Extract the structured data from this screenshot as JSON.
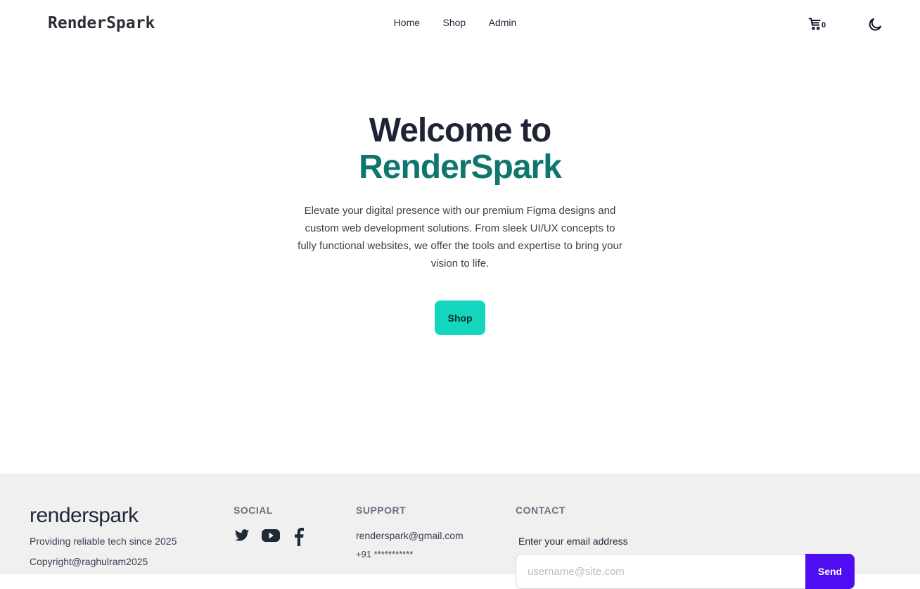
{
  "navbar": {
    "brand": "RenderSpark",
    "links": [
      "Home",
      "Shop",
      "Admin"
    ],
    "cart_count": "0",
    "cart_icon": "shopping-cart-icon",
    "theme_icon": "moon-icon"
  },
  "hero": {
    "title_line1": "Welcome to",
    "title_line2": "RenderSpark",
    "description": "Elevate your digital presence with our premium Figma designs and custom web development solutions. From sleek UI/UX concepts to fully functional websites, we offer the tools and expertise to bring your vision to life.",
    "cta_label": "Shop"
  },
  "footer": {
    "logo": "renderspark",
    "tagline": "Providing reliable tech since 2025",
    "copyright": "Copyright@raghulram2025",
    "social": {
      "heading": "SOCIAL",
      "icons": [
        "twitter-icon",
        "youtube-icon",
        "facebook-icon"
      ]
    },
    "support": {
      "heading": "SUPPORT",
      "email": "renderspark@gmail.com",
      "phone": "+91 ***********"
    },
    "contact": {
      "heading": "CONTACT",
      "label": "Enter your email address",
      "placeholder": "username@site.com",
      "value": "",
      "button_label": "Send"
    }
  },
  "colors": {
    "accent_teal": "#0f766e",
    "button_teal": "#14d6bf",
    "send_purple": "#4f0df2",
    "footer_bg": "#f0f0f0"
  }
}
